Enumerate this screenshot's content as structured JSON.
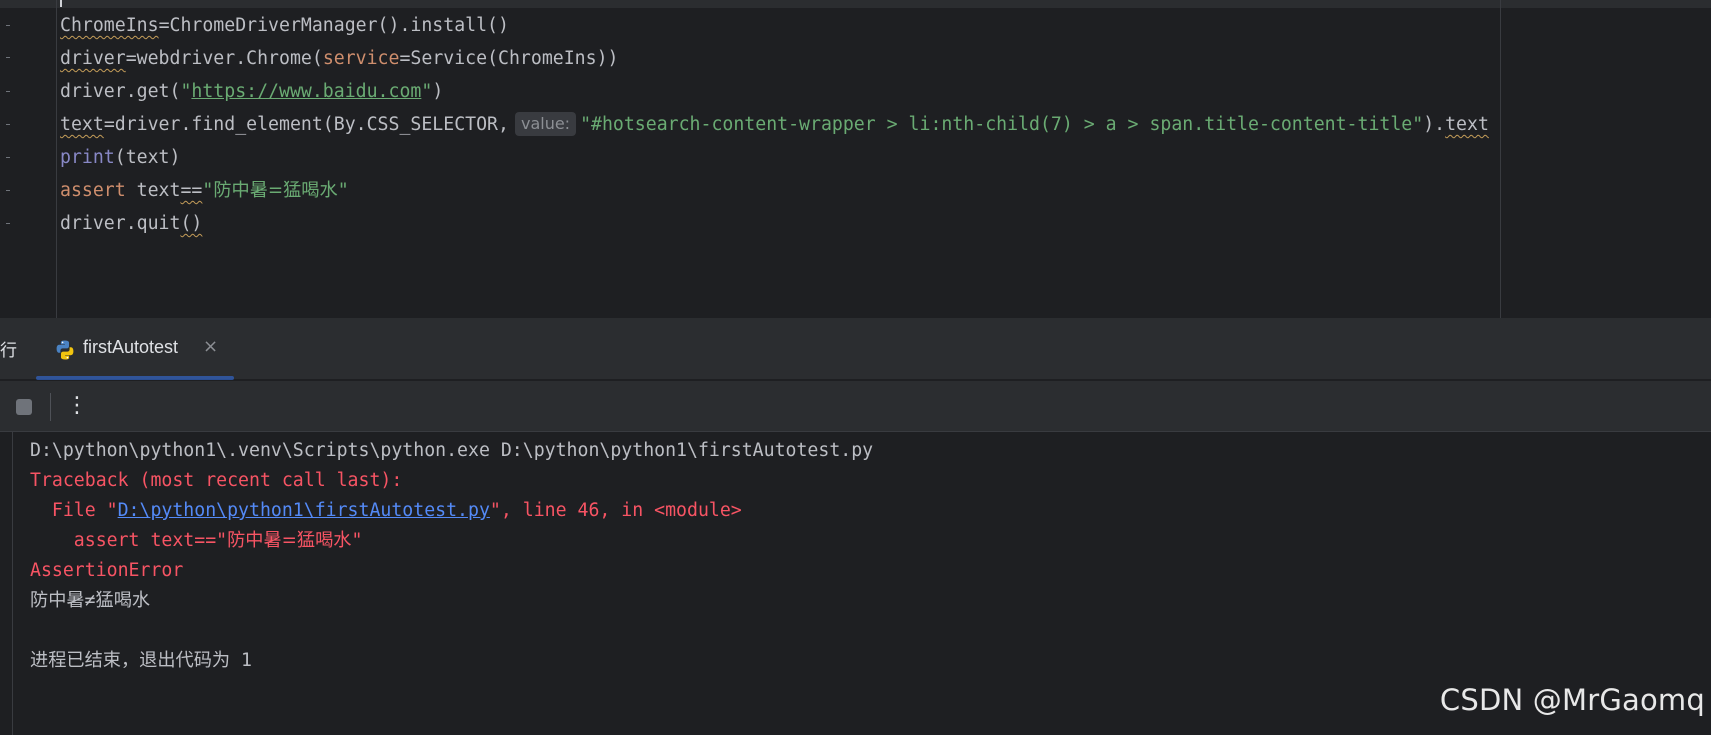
{
  "editor": {
    "line1": {
      "a": "ChromeIns",
      "b": "=ChromeDriverManager().install()"
    },
    "line2": {
      "a": "driver",
      "b": "=webdriver.Chrome(",
      "kwarg": "service",
      "c": "=Service(ChromeIns))"
    },
    "line3": {
      "a": "driver.get(",
      "q1": "\"",
      "url": "https://www.baidu.com",
      "q2": "\"",
      "b": ")"
    },
    "line4": {
      "a": "text",
      "b": "=driver.find_element(By.CSS_SELECTOR,",
      "hint": "value:",
      "str": "\"#hotsearch-content-wrapper > li:nth-child(7) > a > span.title-content-title\"",
      "c": ").",
      "d": "text"
    },
    "line5": {
      "builtin": "print",
      "b": "(text)"
    },
    "line6": {
      "kw": "assert",
      "b": " text",
      "op": "==",
      "q1": "\"",
      "s": "防中暑=猛喝水",
      "q2": "\""
    },
    "line7": {
      "a": "driver.quit",
      "b": "()"
    }
  },
  "tool_window": {
    "left_glyph": "行",
    "tab_label": "firstAutotest",
    "tab_close": "×"
  },
  "toolbar": {
    "more": "⋮"
  },
  "console": {
    "line1": "D:\\python\\python1\\.venv\\Scripts\\python.exe D:\\python\\python1\\firstAutotest.py",
    "line2": "Traceback (most recent call last):",
    "line3": {
      "pre": "  File \"",
      "link": "D:\\python\\python1\\firstAutotest.py",
      "post": "\", line 46, in <module>"
    },
    "line4": {
      "pre": "    assert text==\"",
      "s": "防中暑=猛喝水",
      "post": "\""
    },
    "line5": "AssertionError",
    "line6": "防中暑≠猛喝水",
    "line7": {
      "a": "进程已结束，退出代码为",
      "b": " 1"
    }
  },
  "watermark": "CSDN @MrGaomq",
  "colors": {
    "editor_bg": "#1e1f22",
    "panel_bg": "#2b2d30",
    "keyword": "#cf8e6d",
    "string": "#6aab73",
    "error": "#f75464",
    "link": "#548af7"
  }
}
